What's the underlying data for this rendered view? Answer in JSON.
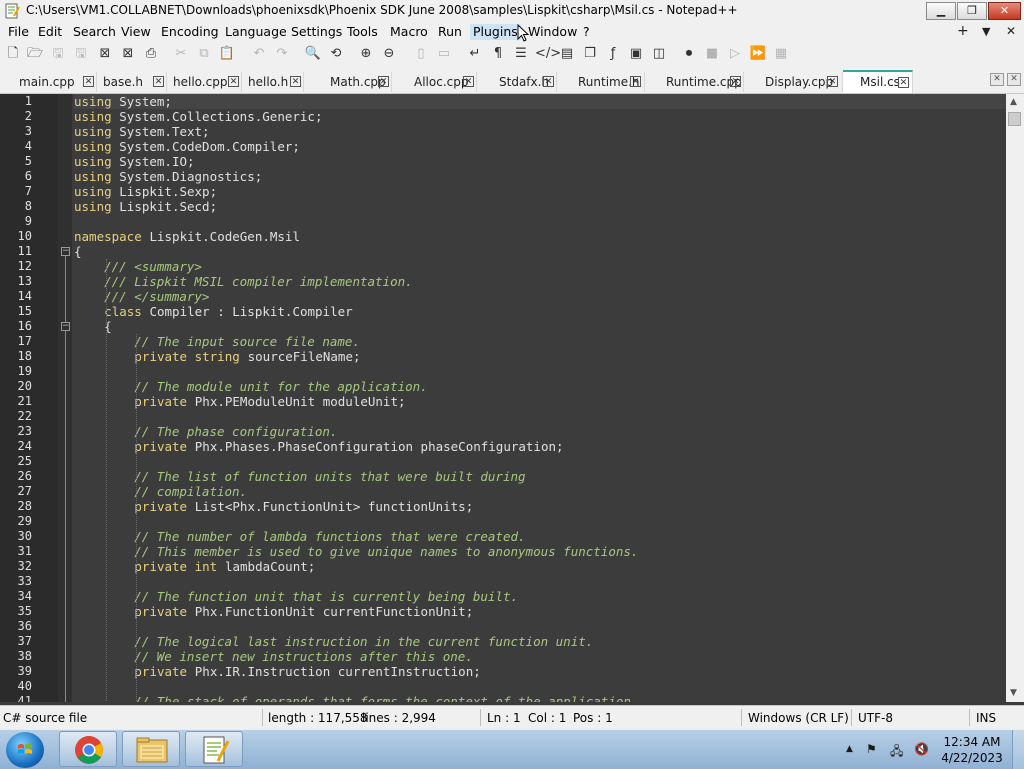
{
  "window": {
    "title": "C:\\Users\\VM1.COLLABNET\\Downloads\\phoenixsdk\\Phoenix SDK June 2008\\samples\\Lispkit\\csharp\\Msil.cs - Notepad++",
    "minimize_icon": "minimize-icon",
    "maximize_icon": "restore-icon",
    "close_icon": "close-icon"
  },
  "menu": {
    "items": [
      "File",
      "Edit",
      "Search",
      "View",
      "Encoding",
      "Language",
      "Settings",
      "Tools",
      "Macro",
      "Run",
      "Plugins",
      "Window",
      "?"
    ],
    "active": "Plugins",
    "right_controls": [
      "+",
      "▼",
      "✕"
    ]
  },
  "toolbar": {
    "buttons": [
      "new-file-icon",
      "open-file-icon",
      "save-icon",
      "save-all-icon",
      "close-icon",
      "close-all-icon",
      "print-icon",
      "cut-icon",
      "copy-icon",
      "paste-icon",
      "undo-icon",
      "redo-icon",
      "find-icon",
      "replace-icon",
      "zoom-in-icon",
      "zoom-out-icon",
      "sync-vertical-icon",
      "sync-horizontal-icon",
      "word-wrap-icon",
      "show-all-chars-icon",
      "indent-guide-icon",
      "xml-tag-icon",
      "doc-map-icon",
      "function-list-icon",
      "folder-workspace-icon",
      "monitor-icon",
      "record-macro-icon",
      "stop-record-icon",
      "play-macro-icon",
      "run-macro-multiple-icon",
      "save-macro-icon"
    ]
  },
  "tabs": [
    {
      "label": "main.cpp",
      "active": false
    },
    {
      "label": "base.h",
      "active": false
    },
    {
      "label": "hello.cpp",
      "active": false
    },
    {
      "label": "hello.h",
      "active": false
    },
    {
      "label": "Math.cpp",
      "active": false
    },
    {
      "label": "Alloc.cpp",
      "active": false
    },
    {
      "label": "Stdafx.h",
      "active": false
    },
    {
      "label": "Runtime.h",
      "active": false
    },
    {
      "label": "Runtime.cpp",
      "active": false
    },
    {
      "label": "Display.cpp",
      "active": false
    },
    {
      "label": "Msil.cs",
      "active": true
    }
  ],
  "editor": {
    "lines": [
      {
        "n": "1",
        "parts": [
          [
            "kw",
            "using"
          ],
          [
            "tx",
            " System;"
          ]
        ]
      },
      {
        "n": "2",
        "parts": [
          [
            "kw",
            "using"
          ],
          [
            "tx",
            " System.Collections.Generic;"
          ]
        ]
      },
      {
        "n": "3",
        "parts": [
          [
            "kw",
            "using"
          ],
          [
            "tx",
            " System.Text;"
          ]
        ]
      },
      {
        "n": "4",
        "parts": [
          [
            "kw",
            "using"
          ],
          [
            "tx",
            " System.CodeDom.Compiler;"
          ]
        ]
      },
      {
        "n": "5",
        "parts": [
          [
            "kw",
            "using"
          ],
          [
            "tx",
            " System.IO;"
          ]
        ]
      },
      {
        "n": "6",
        "parts": [
          [
            "kw",
            "using"
          ],
          [
            "tx",
            " System.Diagnostics;"
          ]
        ]
      },
      {
        "n": "7",
        "parts": [
          [
            "kw",
            "using"
          ],
          [
            "tx",
            " Lispkit.Sexp;"
          ]
        ]
      },
      {
        "n": "8",
        "parts": [
          [
            "kw",
            "using"
          ],
          [
            "tx",
            " Lispkit.Secd;"
          ]
        ]
      },
      {
        "n": "9",
        "parts": []
      },
      {
        "n": "10",
        "parts": [
          [
            "kw",
            "namespace"
          ],
          [
            "tx",
            " Lispkit.CodeGen.Msil"
          ]
        ]
      },
      {
        "n": "11",
        "parts": [
          [
            "tx",
            "{"
          ]
        ]
      },
      {
        "n": "12",
        "parts": [
          [
            "cm",
            "    /// <summary>"
          ]
        ]
      },
      {
        "n": "13",
        "parts": [
          [
            "cm",
            "    /// Lispkit MSIL compiler implementation."
          ]
        ]
      },
      {
        "n": "14",
        "parts": [
          [
            "cm",
            "    /// </summary>"
          ]
        ]
      },
      {
        "n": "15",
        "parts": [
          [
            "tx",
            "    "
          ],
          [
            "kw",
            "class"
          ],
          [
            "tx",
            " Compiler : Lispkit.Compiler"
          ]
        ]
      },
      {
        "n": "16",
        "parts": [
          [
            "tx",
            "    {"
          ]
        ]
      },
      {
        "n": "17",
        "parts": [
          [
            "cm",
            "        // The input source file name."
          ]
        ]
      },
      {
        "n": "18",
        "parts": [
          [
            "tx",
            "        "
          ],
          [
            "kw",
            "private string"
          ],
          [
            "tx",
            " sourceFileName;"
          ]
        ]
      },
      {
        "n": "19",
        "parts": []
      },
      {
        "n": "20",
        "parts": [
          [
            "cm",
            "        // The module unit for the application."
          ]
        ]
      },
      {
        "n": "21",
        "parts": [
          [
            "tx",
            "        "
          ],
          [
            "kw",
            "private"
          ],
          [
            "tx",
            " Phx.PEModuleUnit moduleUnit;"
          ]
        ]
      },
      {
        "n": "22",
        "parts": []
      },
      {
        "n": "23",
        "parts": [
          [
            "cm",
            "        // The phase configuration."
          ]
        ]
      },
      {
        "n": "24",
        "parts": [
          [
            "tx",
            "        "
          ],
          [
            "kw",
            "private"
          ],
          [
            "tx",
            " Phx.Phases.PhaseConfiguration phaseConfiguration;"
          ]
        ]
      },
      {
        "n": "25",
        "parts": []
      },
      {
        "n": "26",
        "parts": [
          [
            "cm",
            "        // The list of function units that were built during"
          ]
        ]
      },
      {
        "n": "27",
        "parts": [
          [
            "cm",
            "        // compilation."
          ]
        ]
      },
      {
        "n": "28",
        "parts": [
          [
            "tx",
            "        "
          ],
          [
            "kw",
            "private"
          ],
          [
            "tx",
            " List<Phx.FunctionUnit> functionUnits;"
          ]
        ]
      },
      {
        "n": "29",
        "parts": []
      },
      {
        "n": "30",
        "parts": [
          [
            "cm",
            "        // The number of lambda functions that were created."
          ]
        ]
      },
      {
        "n": "31",
        "parts": [
          [
            "cm",
            "        // This member is used to give unique names to anonymous functions."
          ]
        ]
      },
      {
        "n": "32",
        "parts": [
          [
            "tx",
            "        "
          ],
          [
            "kw",
            "private int"
          ],
          [
            "tx",
            " lambdaCount;"
          ]
        ]
      },
      {
        "n": "33",
        "parts": []
      },
      {
        "n": "34",
        "parts": [
          [
            "cm",
            "        // The function unit that is currently being built."
          ]
        ]
      },
      {
        "n": "35",
        "parts": [
          [
            "tx",
            "        "
          ],
          [
            "kw",
            "private"
          ],
          [
            "tx",
            " Phx.FunctionUnit currentFunctionUnit;"
          ]
        ]
      },
      {
        "n": "36",
        "parts": []
      },
      {
        "n": "37",
        "parts": [
          [
            "cm",
            "        // The logical last instruction in the current function unit."
          ]
        ]
      },
      {
        "n": "38",
        "parts": [
          [
            "cm",
            "        // We insert new instructions after this one."
          ]
        ]
      },
      {
        "n": "39",
        "parts": [
          [
            "tx",
            "        "
          ],
          [
            "kw",
            "private"
          ],
          [
            "tx",
            " Phx.IR.Instruction currentInstruction;"
          ]
        ]
      },
      {
        "n": "40",
        "parts": []
      },
      {
        "n": "41",
        "parts": [
          [
            "cm",
            "        // The stack of operands that forms the context of the application"
          ]
        ]
      }
    ]
  },
  "status": {
    "file_type": "C# source file",
    "length": "length : 117,558",
    "lines": "lines : 2,994",
    "ln": "Ln : 1",
    "col": "Col : 1",
    "pos": "Pos : 1",
    "eol": "Windows (CR LF)",
    "encoding": "UTF-8",
    "mode": "INS"
  },
  "taskbar": {
    "apps": [
      "chrome-icon",
      "file-explorer-icon",
      "notepad-plus-plus-icon"
    ],
    "tray_icons": [
      "show-hidden-icons-icon",
      "action-center-flag-icon",
      "network-icon",
      "volume-muted-icon"
    ],
    "time": "12:34 AM",
    "date": "4/22/2023"
  }
}
